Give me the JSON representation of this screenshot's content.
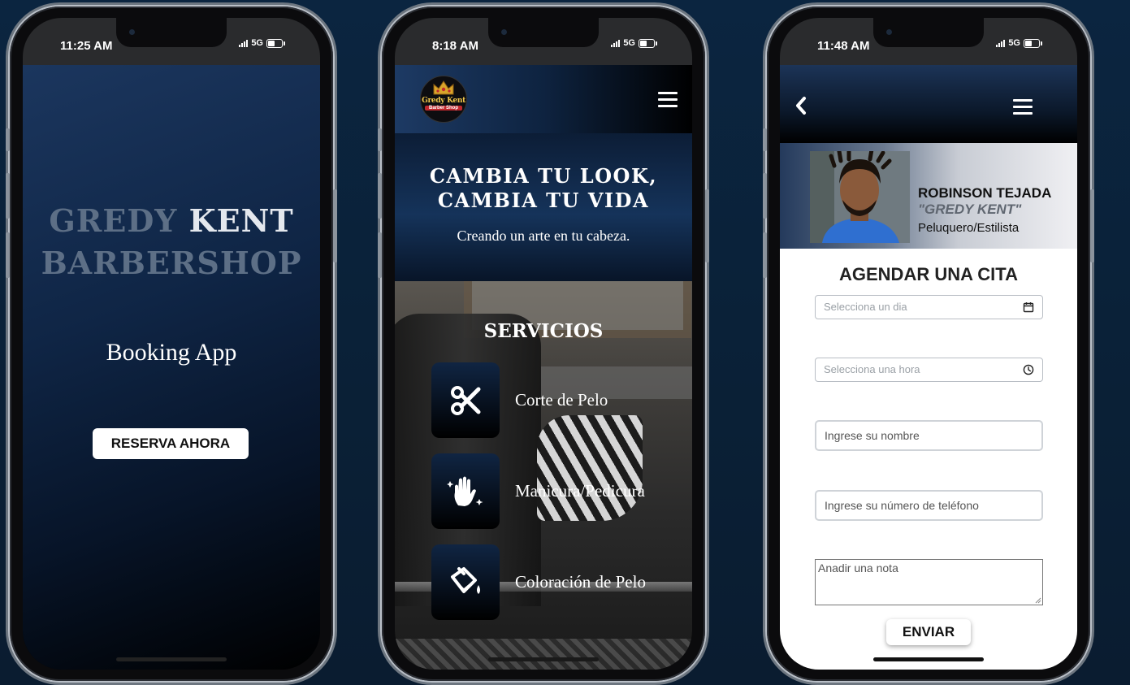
{
  "phone1": {
    "status": {
      "time": "11:25 AM",
      "network": "5G"
    },
    "brand": {
      "line1_part1": "GREDY",
      "line1_part2": "KENT",
      "line2": "BARBERSHOP"
    },
    "subtitle": "Booking App",
    "cta_label": "RESERVA AHORA"
  },
  "phone2": {
    "status": {
      "time": "8:18 AM",
      "network": "5G"
    },
    "logo": {
      "line1": "Gredy Kent",
      "line2": "Barber Shop"
    },
    "hero": {
      "title_line1": "CAMBIA TU LOOK,",
      "title_line2": "CAMBIA TU VIDA",
      "subtitle": "Creando un arte en tu cabeza."
    },
    "services": {
      "title": "SERVICIOS",
      "items": [
        {
          "label": "Corte de Pelo",
          "icon": "scissors-icon"
        },
        {
          "label": "Manicura/Pedicura",
          "icon": "sparkle-hand-icon"
        },
        {
          "label": "Coloración de Pelo",
          "icon": "paint-bucket-icon"
        }
      ]
    }
  },
  "phone3": {
    "status": {
      "time": "11:48 AM",
      "network": "5G"
    },
    "profile": {
      "name": "ROBINSON TEJADA",
      "alias": "\"GREDY KENT\"",
      "role": "Peluquero/Estilista"
    },
    "form": {
      "title": "AGENDAR UNA CITA",
      "date_placeholder": "Selecciona un dia",
      "time_placeholder": "Selecciona una hora",
      "name_placeholder": "Ingrese su nombre",
      "phone_placeholder": "Ingrese su número de teléfono",
      "note_placeholder": "Anadir una nota",
      "submit_label": "ENVIAR"
    }
  },
  "colors": {
    "background": "#0b2540",
    "accent_navy": "#102543",
    "white": "#ffffff"
  }
}
